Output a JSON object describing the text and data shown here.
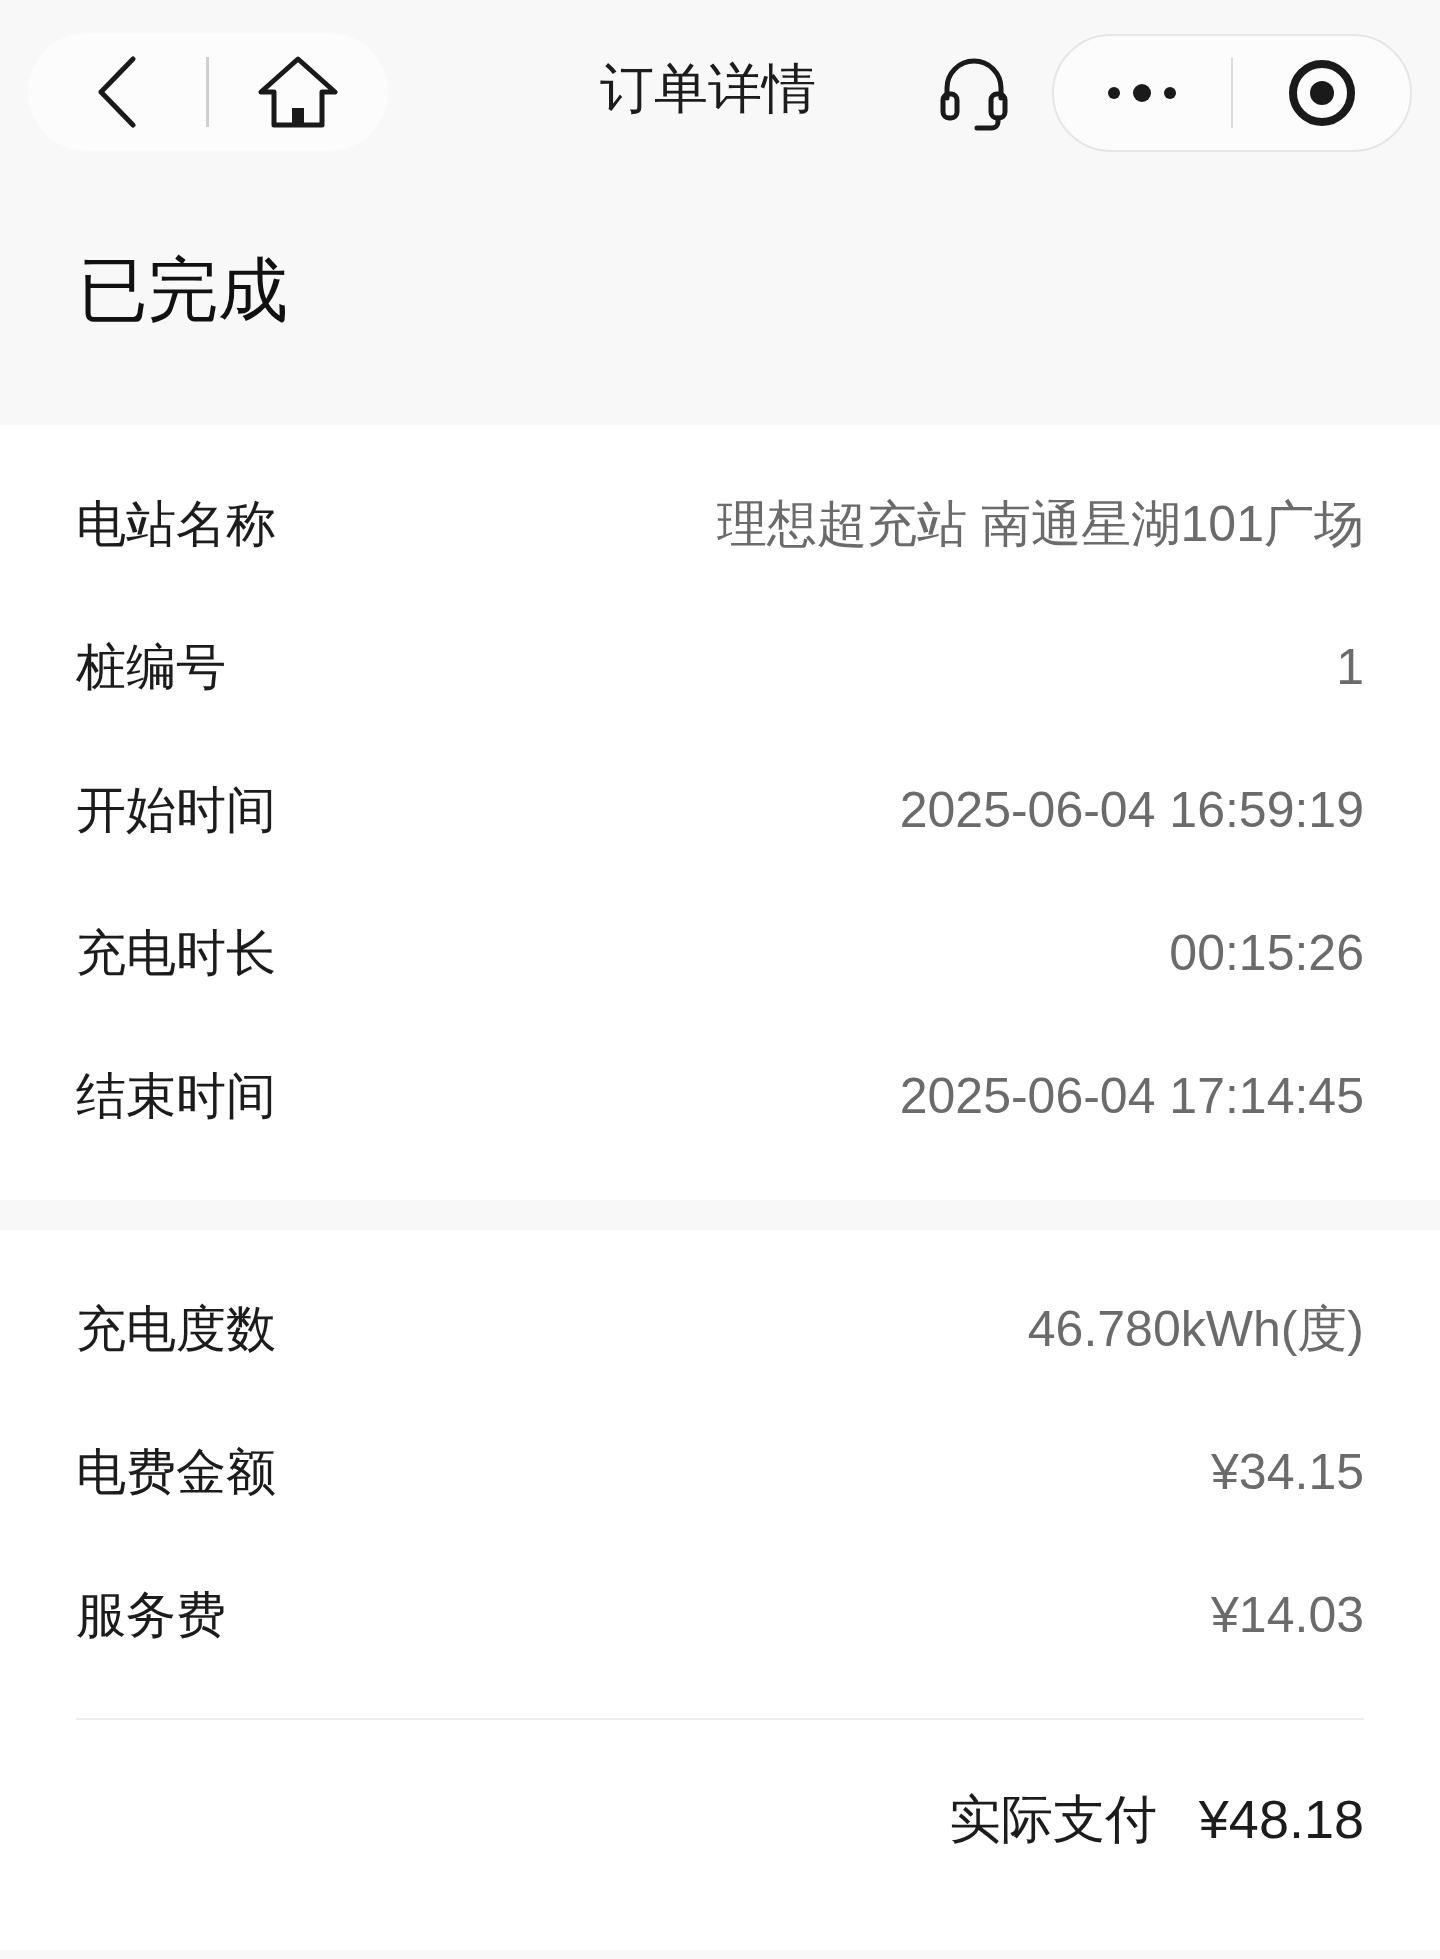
{
  "nav_bar": {
    "title": "订单详情"
  },
  "status": "已完成",
  "order_info": [
    {
      "label": "电站名称",
      "value": "理想超充站 南通星湖101广场"
    },
    {
      "label": "桩编号",
      "value": "1"
    },
    {
      "label": "开始时间",
      "value": "2025-06-04 16:59:19"
    },
    {
      "label": "充电时长",
      "value": "00:15:26"
    },
    {
      "label": "结束时间",
      "value": "2025-06-04 17:14:45"
    }
  ],
  "fees": [
    {
      "label": "充电度数",
      "value": "46.780kWh(度)"
    },
    {
      "label": "电费金额",
      "value": "¥34.15"
    },
    {
      "label": "服务费",
      "value": "¥14.03"
    }
  ],
  "total": {
    "label": "实际支付",
    "value": "¥48.18"
  }
}
